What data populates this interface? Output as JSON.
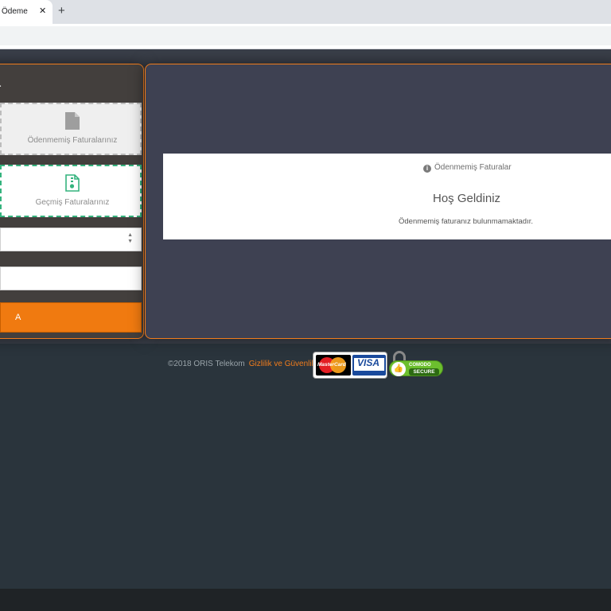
{
  "browser": {
    "tab_title": "Ödeme",
    "tab_close": "✕",
    "new_tab": "+"
  },
  "sidebar": {
    "heading": "r",
    "unpaid_card_label": "Ödenmemiş Faturalarınız",
    "past_card_label": "Geçmiş Faturalarınız",
    "select_arrows": "▲▼",
    "submit_label": "A"
  },
  "main": {
    "info_header": "Ödenmemiş Faturalar",
    "info_icon": "i",
    "title": "Hoş Geldiniz",
    "message": "Ödenmemiş faturanız bulunmamaktadır."
  },
  "footer": {
    "copyright": "©2018 ORIS Telekom",
    "privacy_link": "Gizlilik ve Güvenlik",
    "mastercard_text": "MasterCard",
    "visa_text": "VISA",
    "comodo_top": "COMODO",
    "comodo_bottom": "SECURE"
  },
  "colors": {
    "accent": "#f07c1c",
    "page_bg": "#2a343c",
    "panel_left": "#433f3d",
    "panel_right": "#3e4152",
    "success": "#35b37e"
  }
}
